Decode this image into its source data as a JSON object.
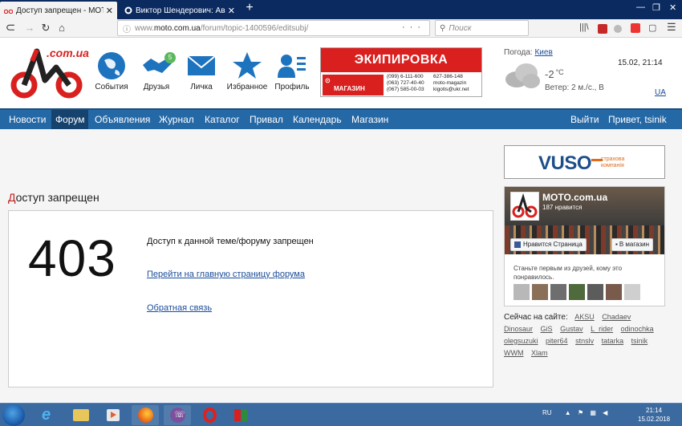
{
  "browser": {
    "tabs": [
      {
        "title": "Доступ запрещен - MOTO.com",
        "active": true
      },
      {
        "title": "Виктор Шендерович: Авантюр",
        "active": false
      }
    ],
    "url_prefix": "www.",
    "url_host": "moto.com.ua",
    "url_path": "/forum/topic-1400596/editsubj/",
    "search_placeholder": "Поиск",
    "nav_icons": [
      "back-icon",
      "forward-icon",
      "reload-icon",
      "home-icon"
    ]
  },
  "site": {
    "logo_text": ".com.ua",
    "nav": [
      {
        "label": "События",
        "icon": "globe-icon",
        "badge": ""
      },
      {
        "label": "Друзья",
        "icon": "handshake-icon",
        "badge": "5"
      },
      {
        "label": "Личка",
        "icon": "envelope-icon",
        "badge": ""
      },
      {
        "label": "Избранное",
        "icon": "star-icon",
        "badge": ""
      },
      {
        "label": "Профиль",
        "icon": "profile-icon",
        "badge": ""
      }
    ],
    "ad": {
      "title": "ЭКИПИРОВКА",
      "shop_label": "МАГАЗИН",
      "contacts": [
        "(099) 6-111-600",
        "(063) 727-40-40",
        "(067) 585-00-03",
        "627-386-148",
        "moto-magazin",
        "kigotis@ukr.net"
      ]
    },
    "weather": {
      "label": "Погода:",
      "city": "Киев",
      "temp": "-2",
      "unit": "°C",
      "wind": "Ветер: 2 м./с., В",
      "datetime": "15.02, 21:14",
      "lang": "UA"
    },
    "menu": [
      {
        "label": "Новости",
        "active": false
      },
      {
        "label": "Форум",
        "active": true
      },
      {
        "label": "Объявления",
        "active": false
      },
      {
        "label": "Журнал",
        "active": false
      },
      {
        "label": "Каталог",
        "active": false
      },
      {
        "label": "Привал",
        "active": false
      },
      {
        "label": "Календарь",
        "active": false
      },
      {
        "label": "Магазин",
        "active": false
      }
    ],
    "menu_right": {
      "logout": "Выйти",
      "greeting": "Привет, tsinik"
    }
  },
  "main": {
    "title_first": "Д",
    "title_rest": "оступ запрещен",
    "error_code": "403",
    "error_message": "Доступ к данной теме/форуму запрещен",
    "link_forum": "Перейти на главную страницу форума",
    "link_feedback": "Обратная связь"
  },
  "sidebar": {
    "vuso_logo": "VUSO",
    "vuso_sub_line1": "страхова",
    "vuso_sub_line2": "компанія",
    "fb": {
      "page_name": "MOTO.com.ua",
      "likes": "187 нравится",
      "like_button": "Нравится Страница",
      "shop_button": "В магазин",
      "text": "Станьте первым из друзей, кому это понравилось."
    },
    "online_label": "Сейчас на сайте:",
    "online_users": [
      "AKSU",
      "Chadaev",
      "Dinosaur",
      "GiS",
      "Gustav",
      "L_rider",
      "odinochka",
      "olegsuzuki",
      "piter64",
      "stnslv",
      "tatarka",
      "tsinik",
      "WWM",
      "Xlam"
    ]
  },
  "taskbar": {
    "lang": "RU",
    "time": "21:14",
    "date": "15.02.2018"
  }
}
